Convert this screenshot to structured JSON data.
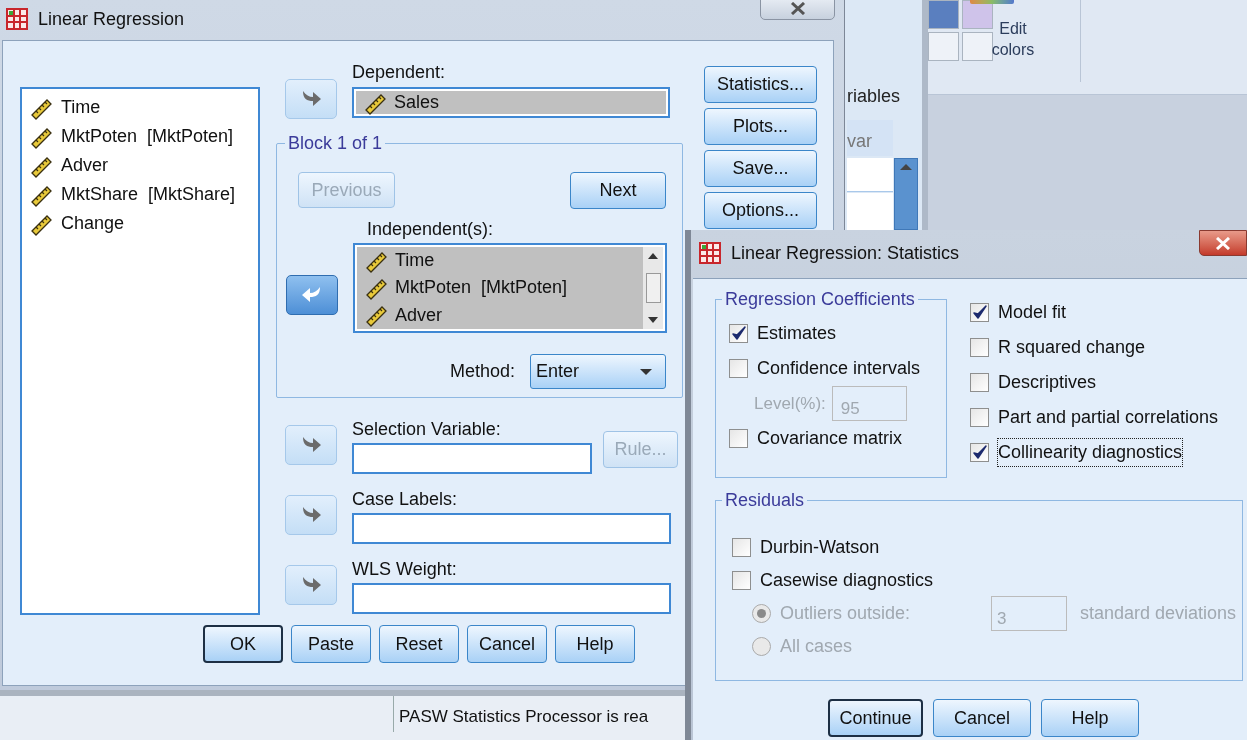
{
  "background": {
    "ribbon_label": "Edit colors",
    "panel_tab": "riables",
    "column_header": "var"
  },
  "main_dialog": {
    "title": "Linear Regression",
    "variables": [
      {
        "name": "Time"
      },
      {
        "name": "MktPoten  [MktPoten]"
      },
      {
        "name": "Adver"
      },
      {
        "name": "MktShare  [MktShare]"
      },
      {
        "name": "Change"
      }
    ],
    "dependent": {
      "label": "Dependent:",
      "arrow": {
        "points_left": false,
        "active": false
      },
      "items": [
        {
          "name": "Sales"
        }
      ]
    },
    "block": {
      "label": "Block 1 of 1",
      "previous": {
        "label": "Previous",
        "disabled": true
      },
      "next": {
        "label": "Next",
        "disabled": false
      },
      "independents": {
        "label": "Independent(s):",
        "arrow": {
          "points_left": true,
          "active": true
        },
        "items": [
          {
            "name": "Time"
          },
          {
            "name": "MktPoten  [MktPoten]"
          },
          {
            "name": "Adver"
          }
        ]
      },
      "method": {
        "label": "Method:",
        "value": "Enter"
      }
    },
    "side_buttons": [
      {
        "label": "Statistics..."
      },
      {
        "label": "Plots..."
      },
      {
        "label": "Save..."
      },
      {
        "label": "Options..."
      }
    ],
    "selection_variable": {
      "label": "Selection Variable:",
      "arrow": {
        "points_left": false,
        "active": false
      },
      "rule_button": {
        "label": "Rule...",
        "disabled": true
      }
    },
    "case_labels": {
      "label": "Case Labels:",
      "arrow": {
        "points_left": false,
        "active": false
      }
    },
    "wls_weight": {
      "label": "WLS Weight:",
      "arrow": {
        "points_left": false,
        "active": false
      }
    },
    "buttons": [
      {
        "label": "OK",
        "default": true
      },
      {
        "label": "Paste",
        "default": false
      },
      {
        "label": "Reset",
        "default": false
      },
      {
        "label": "Cancel",
        "default": false
      },
      {
        "label": "Help",
        "default": false
      }
    ]
  },
  "status_bar": {
    "text": "PASW Statistics Processor is rea"
  },
  "stats_dialog": {
    "title": "Linear Regression: Statistics",
    "coefficients": {
      "label": "Regression Coefficients",
      "options": [
        {
          "kind": "checkbox",
          "label": "Estimates",
          "checked": true,
          "focused": false
        },
        {
          "kind": "checkbox",
          "label": "Confidence intervals",
          "checked": false,
          "focused": false
        },
        {
          "kind": "level",
          "label": "Level(%):",
          "value": "95",
          "disabled": true
        },
        {
          "kind": "checkbox",
          "label": "Covariance matrix",
          "checked": false,
          "focused": false
        }
      ]
    },
    "options": [
      {
        "label": "Model fit",
        "checked": true,
        "focused": false
      },
      {
        "label": "R squared change",
        "checked": false,
        "focused": false
      },
      {
        "label": "Descriptives",
        "checked": false,
        "focused": false
      },
      {
        "label": "Part and partial correlations",
        "checked": false,
        "focused": false
      },
      {
        "label": "Collinearity diagnostics",
        "checked": true,
        "focused": true
      }
    ],
    "residuals": {
      "label": "Residuals",
      "options": [
        {
          "kind": "checkbox",
          "label": "Durbin-Watson",
          "checked": false
        },
        {
          "kind": "checkbox",
          "label": "Casewise diagnostics",
          "checked": false
        },
        {
          "kind": "radio",
          "label": "Outliers outside:",
          "selected": true,
          "disabled": true,
          "value": "3",
          "suffix": "standard deviations"
        },
        {
          "kind": "radio",
          "label": "All cases",
          "selected": false,
          "disabled": true
        }
      ]
    },
    "buttons": [
      {
        "label": "Continue",
        "default": true
      },
      {
        "label": "Cancel",
        "default": false
      },
      {
        "label": "Help",
        "default": false
      }
    ]
  }
}
